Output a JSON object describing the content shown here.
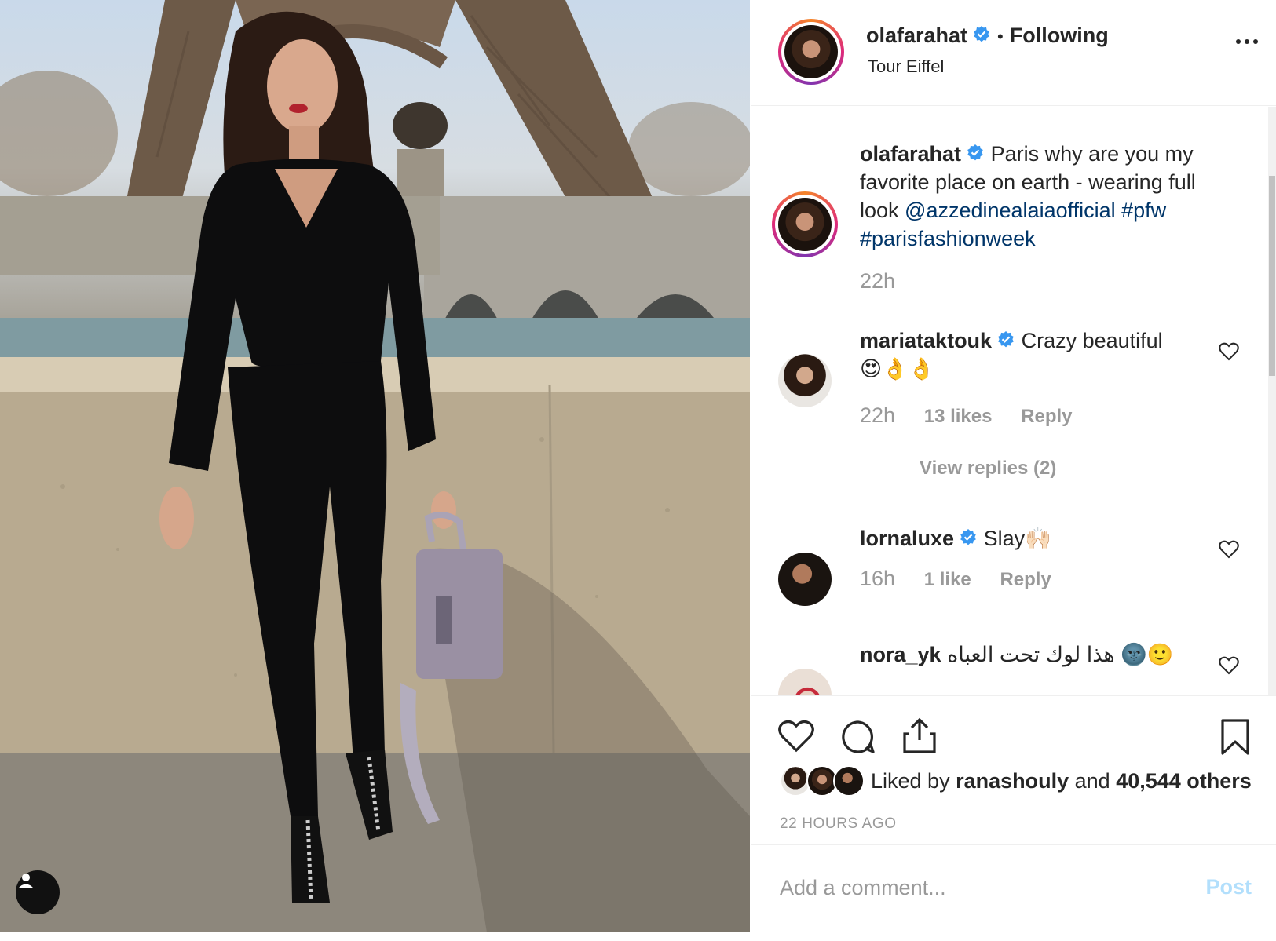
{
  "post": {
    "author": "olafarahat",
    "follow_status": "Following",
    "location": "Tour Eiffel",
    "caption": {
      "author": "olafarahat",
      "text_plain": "Paris why are you my favorite place on earth - wearing full look ",
      "mention": "@azzedinealaiaofficial",
      "hashtag1": "#pfw",
      "hashtag2": "#parisfashionweek",
      "time": "22h"
    },
    "comments": [
      {
        "user": "mariataktouk",
        "verified": true,
        "text": "Crazy beautiful",
        "emoji": "😍👌👌",
        "time": "22h",
        "likes": "13 likes",
        "reply": "Reply"
      },
      {
        "user": "lornaluxe",
        "verified": true,
        "text": "Slay🙌🏻",
        "time": "16h",
        "likes": "1 like",
        "reply": "Reply"
      },
      {
        "user": "nora_yk",
        "verified": false,
        "text": "هذا لوك تحت العباه 🌚🙂"
      }
    ],
    "view_replies": "View replies (2)",
    "likes_line": {
      "prefix": "Liked by ",
      "user": "ranashouly",
      "middle": " and ",
      "count": "40,544 others"
    },
    "time_ago": "22 HOURS AGO",
    "add_comment_placeholder": "Add a comment...",
    "post_button": "Post"
  },
  "icons": {
    "more": "more-options-icon",
    "like": "heart-icon",
    "comment": "comment-bubble-icon",
    "share": "share-icon",
    "save": "bookmark-icon",
    "tag": "user-tag-icon",
    "verified": "verified-badge-icon"
  },
  "colors": {
    "link": "#003569",
    "verified": "#3897f0",
    "muted": "#999999",
    "post_disabled": "#b2dffc"
  }
}
